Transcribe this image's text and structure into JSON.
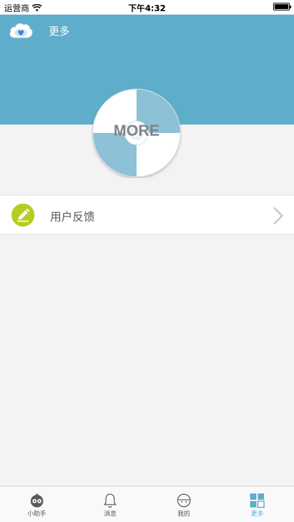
{
  "status_bar": {
    "carrier": "运营商",
    "time": "下午4:32"
  },
  "header": {
    "title": "更多",
    "background_color": "#5eaecb",
    "icon": "cloud-heart-icon"
  },
  "banner": {
    "label": "MORE",
    "icon": "disc-icon"
  },
  "list": {
    "items": [
      {
        "label": "用户反馈",
        "icon": "edit-pencil-icon",
        "accent_color": "#b5cc22"
      }
    ]
  },
  "tab_bar": {
    "active_color": "#5eaecb",
    "tabs": [
      {
        "label": "小助手",
        "icon": "robot-assistant-icon",
        "active": false
      },
      {
        "label": "消息",
        "icon": "bell-icon",
        "active": false
      },
      {
        "label": "我的",
        "icon": "face-icon",
        "active": false
      },
      {
        "label": "更多",
        "icon": "grid-icon",
        "active": true
      }
    ]
  }
}
